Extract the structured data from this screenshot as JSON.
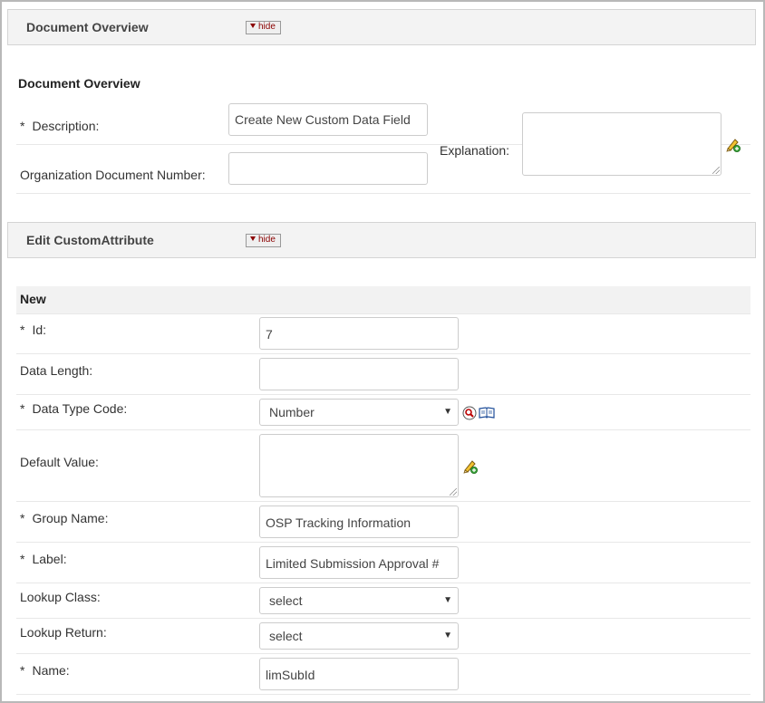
{
  "doc_overview_header": {
    "title": "Document Overview",
    "hide_label": "hide"
  },
  "doc_overview": {
    "title": "Document Overview",
    "description_label": "Description:",
    "description_value": "Create New Custom Data Field",
    "org_doc_number_label": "Organization Document Number:",
    "org_doc_number_value": "",
    "explanation_label": "Explanation:",
    "required_marker": "*"
  },
  "edit_header": {
    "title": "Edit CustomAttribute",
    "hide_label": "hide"
  },
  "edit": {
    "new_label": "New",
    "required_marker": "*",
    "id_label": "Id:",
    "id_value": "7",
    "data_length_label": "Data Length:",
    "data_length_value": "",
    "data_type_label": "Data Type Code:",
    "data_type_value": "Number",
    "default_value_label": "Default Value:",
    "group_name_label": "Group Name:",
    "group_name_value": "OSP Tracking Information",
    "label_label": "Label:",
    "label_value": "Limited Submission Approval #",
    "lookup_class_label": "Lookup Class:",
    "lookup_class_value": "select",
    "lookup_return_label": "Lookup Return:",
    "lookup_return_value": "select",
    "name_label": "Name:",
    "name_value": "limSubId"
  },
  "icons": {
    "pencil": "pencil-icon",
    "search": "search-icon",
    "book": "book-icon",
    "dropdown": "chevron-down-icon"
  }
}
